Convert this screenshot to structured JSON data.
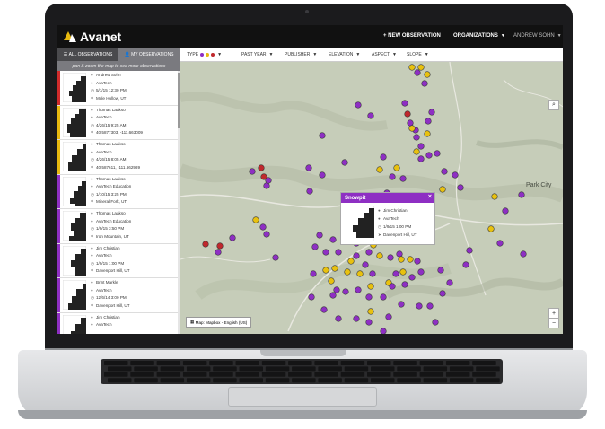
{
  "app": {
    "name": "Avanet",
    "nav": {
      "new_observation": "+ NEW OBSERVATION",
      "organizations": "ORGANIZATIONS",
      "user": "ANDREW SOHN"
    }
  },
  "sidebar": {
    "tabs": [
      "ALL OBSERVATIONS",
      "MY OBSERVATIONS"
    ],
    "hint": "pan & zoom the map to see more observations",
    "observations": [
      {
        "name": "Andrew Sohn",
        "org": "AvaTech",
        "datetime": "5/1/15 12:30 PM",
        "location": "Mule Hollow, UT",
        "color": "#d12b2b"
      },
      {
        "name": "Thomas Laakso",
        "org": "AvaTech",
        "datetime": "4/26/15 9:25 AM",
        "location": "40.5877303, -111.663009",
        "color": "#e8b90f"
      },
      {
        "name": "Thomas Laakso",
        "org": "AvaTech",
        "datetime": "4/26/15 8:05 AM",
        "location": "40.587611, -111.662989",
        "color": "#e8b90f"
      },
      {
        "name": "Thomas Laakso",
        "org": "AvaTech Education",
        "datetime": "1/10/15 3:25 PM",
        "location": "Mineral Fork, UT",
        "color": "#8e2fc3"
      },
      {
        "name": "Thomas Laakso",
        "org": "AvaTech Education",
        "datetime": "1/9/15 3:50 PM",
        "location": "Iron Mountain, UT",
        "color": "#8e2fc3"
      },
      {
        "name": "Jim Christian",
        "org": "AvaTech",
        "datetime": "1/9/15 1:00 PM",
        "location": "Davenport Hill, UT",
        "color": "#8e2fc3"
      },
      {
        "name": "Brint Markle",
        "org": "AvaTech",
        "datetime": "12/6/14 3:00 PM",
        "location": "Davenport Hill, UT",
        "color": "#8e2fc3"
      },
      {
        "name": "Jim Christian",
        "org": "AvaTech",
        "datetime": "",
        "location": "",
        "color": "#8e2fc3"
      }
    ]
  },
  "filters": {
    "type": "TYPE",
    "type_colors": [
      "#8e2fc3",
      "#e8b90f",
      "#c0282d"
    ],
    "items": [
      "PAST YEAR",
      "PUBLISHER",
      "ELEVATION",
      "ASPECT",
      "SLOPE"
    ]
  },
  "map": {
    "attribution": "Map: Mapbox - English (US)",
    "town": "Park City",
    "zoom_in": "+",
    "zoom_out": "−",
    "markers": {
      "purple": "#8e2fc3",
      "yellow": "#e8c10f",
      "red": "#c0282d"
    }
  },
  "popup": {
    "title": "Snowpit",
    "close": "×",
    "name": "Jim Christian",
    "org": "AvaTech",
    "datetime": "1/9/15 1:00 PM",
    "location": "Davenport Hill, UT"
  },
  "icons": {
    "user": "user-icon",
    "org": "group-icon",
    "clock": "clock-icon",
    "pin": "location-pin-icon"
  }
}
